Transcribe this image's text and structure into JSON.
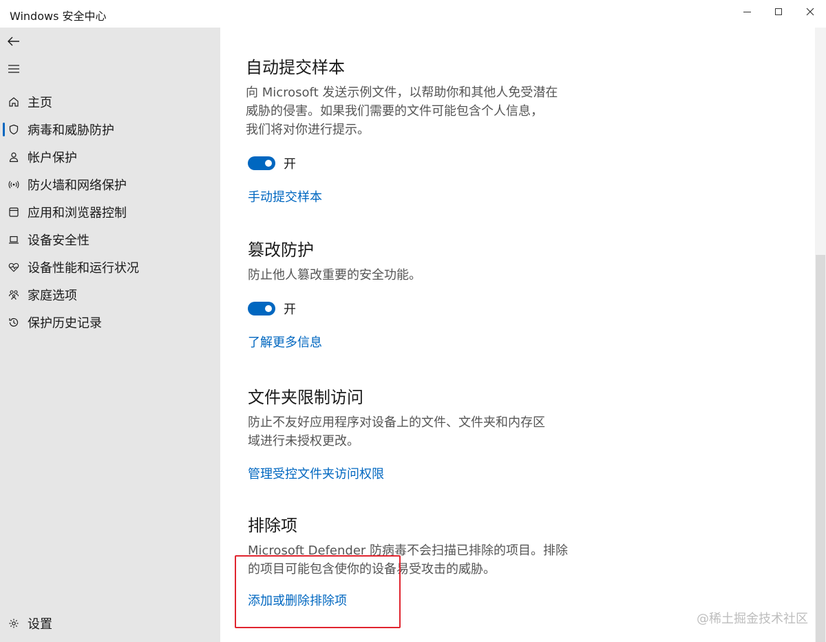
{
  "window": {
    "title": "Windows 安全中心"
  },
  "sidebar": {
    "back_icon": "back-arrow-icon",
    "menu_icon": "hamburger-icon",
    "items": [
      {
        "label": "主页",
        "icon": "home-icon"
      },
      {
        "label": "病毒和威胁防护",
        "icon": "shield-icon",
        "active": true
      },
      {
        "label": "帐户保护",
        "icon": "person-icon"
      },
      {
        "label": "防火墙和网络保护",
        "icon": "wifi-signal-icon"
      },
      {
        "label": "应用和浏览器控制",
        "icon": "app-window-icon"
      },
      {
        "label": "设备安全性",
        "icon": "laptop-icon"
      },
      {
        "label": "设备性能和运行状况",
        "icon": "heart-pulse-icon"
      },
      {
        "label": "家庭选项",
        "icon": "family-icon"
      },
      {
        "label": "保护历史记录",
        "icon": "history-icon"
      }
    ],
    "settings": {
      "label": "设置",
      "icon": "gear-icon"
    }
  },
  "main": {
    "auto_submit": {
      "title": "自动提交样本",
      "desc_lines": [
        "向 Microsoft 发送示例文件，以帮助你和其他人免受潜在",
        "威胁的侵害。如果我们需要的文件可能包含个人信息，",
        "我们将对你进行提示。"
      ],
      "toggle_label": "开",
      "toggle_on": true,
      "link": "手动提交样本"
    },
    "tamper": {
      "title": "篡改防护",
      "desc_lines": [
        "防止他人篡改重要的安全功能。"
      ],
      "toggle_label": "开",
      "toggle_on": true,
      "link": "了解更多信息"
    },
    "folder_access": {
      "title": "文件夹限制访问",
      "desc_lines": [
        "防止不友好应用程序对设备上的文件、文件夹和内存区",
        "域进行未授权更改。"
      ],
      "link": "管理受控文件夹访问权限"
    },
    "exclusions": {
      "title": "排除项",
      "desc_lines": [
        "Microsoft Defender 防病毒不会扫描已排除的项目。排除",
        "的项目可能包含使你的设备易受攻击的威胁。"
      ],
      "link": "添加或删除排除项"
    }
  },
  "watermark": "@稀土掘金技术社区",
  "colors": {
    "accent": "#0067c0",
    "highlight": "#e0242e",
    "sidebar_bg": "#e6e6e6"
  }
}
